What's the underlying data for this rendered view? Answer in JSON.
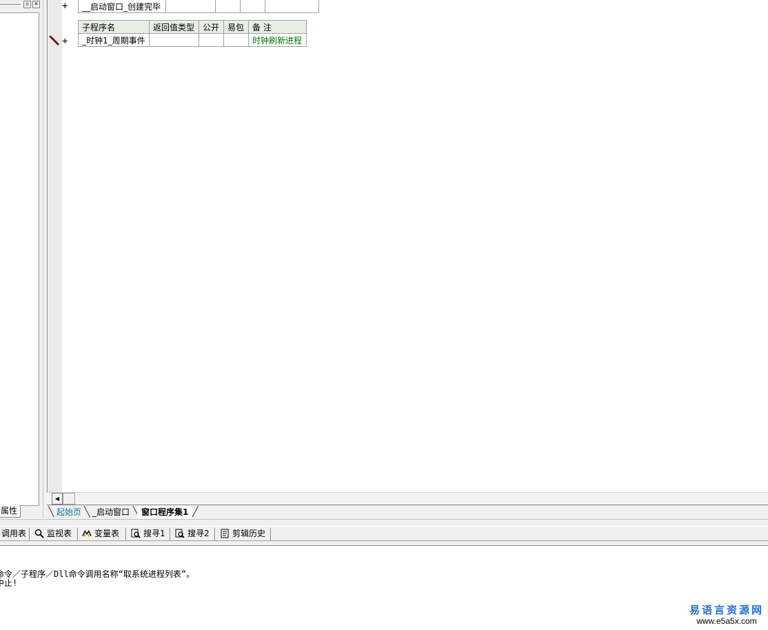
{
  "left_panel": {
    "property_tab_label": "属性",
    "restore_button": "▫",
    "close_button": "×"
  },
  "code_tables": {
    "first_table": {
      "row": {
        "name": "__启动窗口_创建完毕"
      }
    },
    "second_table": {
      "headers": [
        "子程序名",
        "返回值类型",
        "公开",
        "易包",
        "备 注"
      ],
      "row": {
        "name": "_时钟1_周期事件",
        "return_type": "",
        "public": "",
        "epkg": "",
        "remark": "时钟刷新进程"
      }
    },
    "plus_symbol": "+"
  },
  "editor_tabs": [
    {
      "label": "起始页"
    },
    {
      "label": "_启动窗口"
    },
    {
      "label": "窗口程序集1"
    }
  ],
  "lower_toolbar": {
    "tabs": [
      {
        "label": "调用表",
        "icon": "call-table-icon"
      },
      {
        "label": "监视表",
        "icon": "magnifier-icon"
      },
      {
        "label": "变量表",
        "icon": "variable-icon"
      },
      {
        "label": "搜寻1",
        "icon": "search1-icon"
      },
      {
        "label": "搜寻2",
        "icon": "search2-icon"
      },
      {
        "label": "剪辑历史",
        "icon": "clipboard-history-icon"
      }
    ]
  },
  "output": {
    "line1": "命令／子程序／Dll命令调用名称“取系统进程列表”。",
    "line2": "中止!"
  },
  "watermark": {
    "cn": "易语言资源网",
    "url": "www.e5a5x.com"
  },
  "colors": {
    "header_bg": "#e7efe4",
    "remark_green": "#007000",
    "start_tab_teal": "#007b9a",
    "watermark_blue": "#2a6fd0"
  }
}
